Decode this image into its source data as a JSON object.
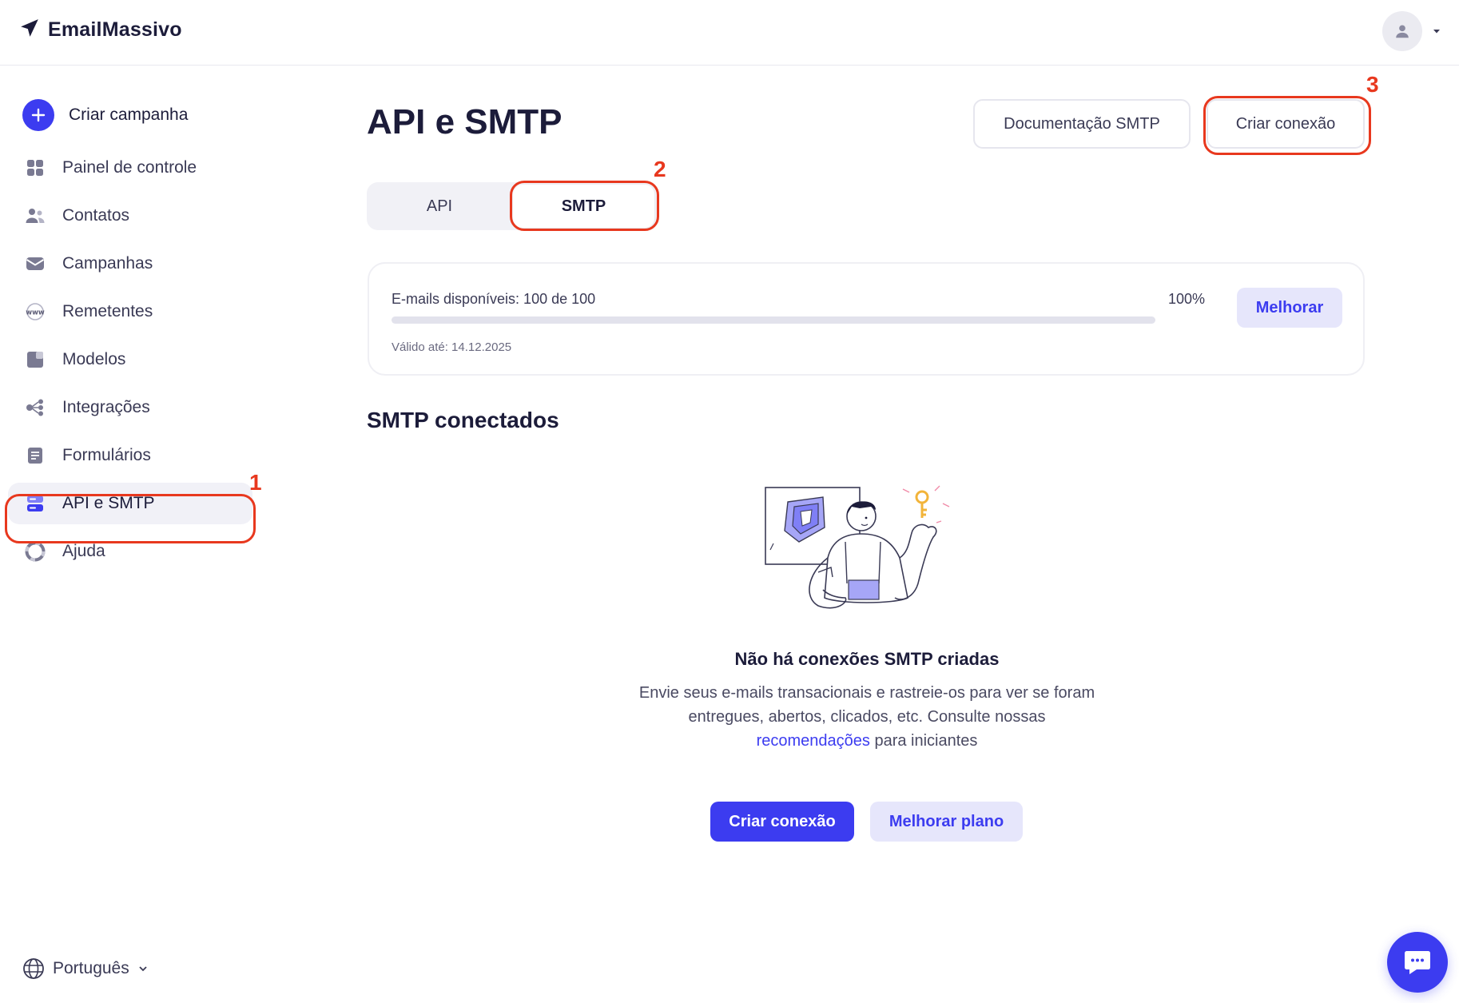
{
  "app": {
    "brand": "EmailMassivo"
  },
  "sidebar": {
    "create_label": "Criar campanha",
    "items": [
      {
        "label": "Painel de controle",
        "icon": "dashboard-icon"
      },
      {
        "label": "Contatos",
        "icon": "contacts-icon"
      },
      {
        "label": "Campanhas",
        "icon": "campaigns-icon"
      },
      {
        "label": "Remetentes",
        "icon": "www-icon"
      },
      {
        "label": "Modelos",
        "icon": "templates-icon"
      },
      {
        "label": "Integrações",
        "icon": "integrations-icon"
      },
      {
        "label": "Formulários",
        "icon": "forms-icon"
      },
      {
        "label": "API e SMTP",
        "icon": "server-icon",
        "active": true
      },
      {
        "label": "Ajuda",
        "icon": "lifebuoy-icon"
      }
    ],
    "language": "Português"
  },
  "main": {
    "title": "API e SMTP",
    "docs_button": "Documentação SMTP",
    "create_button": "Criar conexão",
    "tabs": [
      {
        "label": "API"
      },
      {
        "label": "SMTP",
        "active": true
      }
    ],
    "quota": {
      "label": "E-mails disponíveis: 100 de 100",
      "percent_label": "100%",
      "percent": 100,
      "valid_until": "Válido até: 14.12.2025",
      "upgrade_button": "Melhorar"
    },
    "section_title": "SMTP conectados",
    "empty_state": {
      "title": "Não há conexões SMTP criadas",
      "desc_part1": "Envie seus e-mails transacionais e rastreie-os para ver se foram entregues, abertos, clicados, etc. Consulte nossas",
      "desc_link": "recomendações",
      "desc_part2": "para iniciantes",
      "primary_button": "Criar conexão",
      "secondary_button": "Melhorar plano"
    }
  },
  "annotations": [
    "1",
    "2",
    "3"
  ],
  "colors": {
    "accent": "#3c3cf0",
    "accent_soft": "#e6e6fb",
    "annotation": "#e8381e",
    "text": "#1c1c3a"
  }
}
